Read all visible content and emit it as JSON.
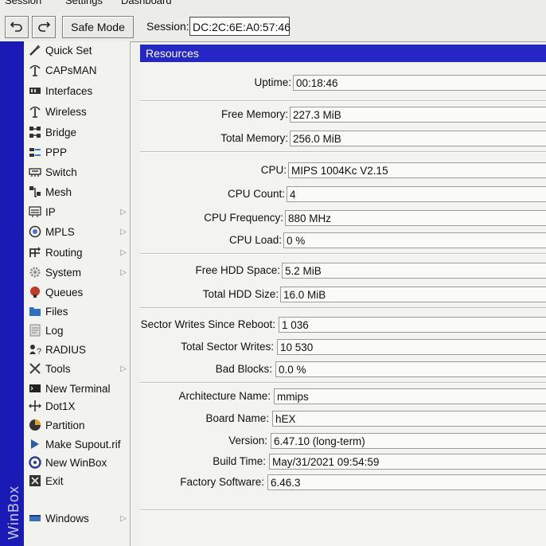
{
  "menu": {
    "items": [
      "Session",
      "Settings",
      "Dashboard"
    ]
  },
  "toolbar": {
    "undo_icon": "undo-icon",
    "redo_icon": "redo-icon",
    "safe_mode_label": "Safe Mode",
    "session_label": "Session:",
    "session_value": "DC:2C:6E:A0:57:46"
  },
  "brand": {
    "vertical_text": "WinBox"
  },
  "sidebar": {
    "items": [
      {
        "label": "Quick Set",
        "icon": "wand-icon"
      },
      {
        "label": "CAPsMAN",
        "icon": "antenna-icon"
      },
      {
        "label": "Interfaces",
        "icon": "interfaces-icon"
      },
      {
        "label": "Wireless",
        "icon": "wireless-icon"
      },
      {
        "label": "Bridge",
        "icon": "bridge-icon"
      },
      {
        "label": "PPP",
        "icon": "ppp-icon"
      },
      {
        "label": "Switch",
        "icon": "switch-icon"
      },
      {
        "label": "Mesh",
        "icon": "mesh-icon"
      },
      {
        "label": "IP",
        "icon": "ip-icon",
        "submenu": true
      },
      {
        "label": "MPLS",
        "icon": "mpls-icon",
        "submenu": true
      },
      {
        "label": "Routing",
        "icon": "routing-icon",
        "submenu": true
      },
      {
        "label": "System",
        "icon": "gear-icon",
        "submenu": true
      },
      {
        "label": "Queues",
        "icon": "queues-icon"
      },
      {
        "label": "Files",
        "icon": "folder-icon"
      },
      {
        "label": "Log",
        "icon": "log-icon"
      },
      {
        "label": "RADIUS",
        "icon": "radius-icon"
      },
      {
        "label": "Tools",
        "icon": "tools-icon",
        "submenu": true
      },
      {
        "label": "New Terminal",
        "icon": "terminal-icon"
      },
      {
        "label": "Dot1X",
        "icon": "dot1x-icon"
      },
      {
        "label": "Partition",
        "icon": "partition-icon"
      },
      {
        "label": "Make Supout.rif",
        "icon": "supout-icon"
      },
      {
        "label": "New WinBox",
        "icon": "winbox-icon"
      },
      {
        "label": "Exit",
        "icon": "exit-icon"
      },
      {
        "label": "Windows",
        "icon": "windows-icon",
        "submenu": true
      }
    ]
  },
  "resources": {
    "title": "Resources",
    "rows": [
      {
        "label": "Uptime:",
        "value": "00:18:46"
      },
      {
        "label": "Free Memory:",
        "value": "227.3 MiB"
      },
      {
        "label": "Total Memory:",
        "value": "256.0 MiB"
      },
      {
        "label": "CPU:",
        "value": "MIPS 1004Kc V2.15"
      },
      {
        "label": "CPU Count:",
        "value": "4"
      },
      {
        "label": "CPU Frequency:",
        "value": "880 MHz"
      },
      {
        "label": "CPU Load:",
        "value": "0 %"
      },
      {
        "label": "Free HDD Space:",
        "value": "5.2 MiB"
      },
      {
        "label": "Total HDD Size:",
        "value": "16.0 MiB"
      },
      {
        "label": "Sector Writes Since Reboot:",
        "value": "1 036"
      },
      {
        "label": "Total Sector Writes:",
        "value": "10 530"
      },
      {
        "label": "Bad Blocks:",
        "value": "0.0 %"
      },
      {
        "label": "Architecture Name:",
        "value": "mmips"
      },
      {
        "label": "Board Name:",
        "value": "hEX"
      },
      {
        "label": "Version:",
        "value": "6.47.10 (long-term)"
      },
      {
        "label": "Build Time:",
        "value": "May/31/2021 09:54:59"
      },
      {
        "label": "Factory Software:",
        "value": "6.46.3"
      }
    ]
  },
  "colors": {
    "accent": "#2427c4",
    "brand_strip": "#1a1bb7"
  }
}
